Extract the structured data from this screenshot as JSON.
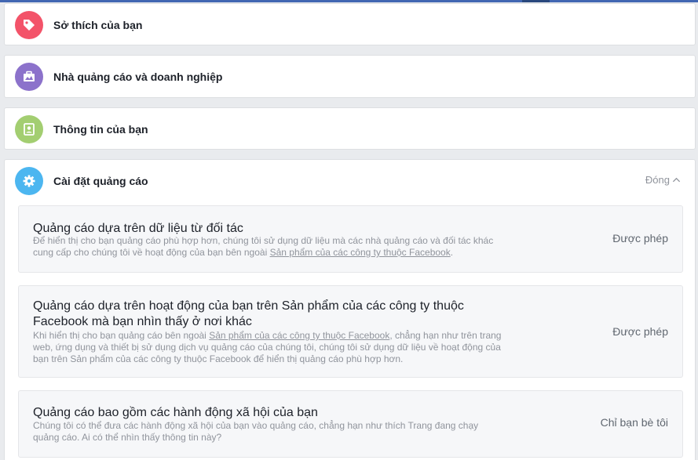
{
  "sections": {
    "interests": {
      "title": "Sở thích của bạn",
      "icon": "tag-icon",
      "color": "#f35369"
    },
    "advertisers": {
      "title": "Nhà quảng cáo và doanh nghiệp",
      "icon": "briefcase-icon",
      "color": "#8c72cb"
    },
    "your_info": {
      "title": "Thông tin của bạn",
      "icon": "id-card-icon",
      "color": "#a3ce71"
    },
    "ad_settings": {
      "title": "Cài đặt quảng cáo",
      "icon": "gear-icon",
      "color": "#4cb6f0",
      "close_label": "Đóng"
    }
  },
  "settings": [
    {
      "title": "Quảng cáo dựa trên dữ liệu từ đối tác",
      "desc_line1": "Để hiển thị cho bạn quảng cáo phù hợp hơn, chúng tôi sử dụng dữ liệu mà các nhà quảng cáo và đối tác khác",
      "desc_line2_pre": "cung cấp cho chúng tôi về hoạt động của bạn bên ngoài ",
      "desc_link": "Sản phẩm của các công ty thuộc Facebook",
      "desc_line2_post": ".",
      "value": "Được phép"
    },
    {
      "title_line1": "Quảng cáo dựa trên hoạt động của bạn trên Sản phẩm của các công ty thuộc",
      "title_line2": "Facebook mà bạn nhìn thấy ở nơi khác",
      "desc_line1_pre": "Khi hiển thị cho bạn quảng cáo bên ngoài ",
      "desc_link": "Sản phẩm của các công ty thuộc Facebook",
      "desc_line1_post": ", chẳng hạn như trên trang",
      "desc_line2": "web, ứng dụng và thiết bị sử dụng dịch vụ quảng cáo của chúng tôi, chúng tôi sử dụng dữ liệu về hoạt động của",
      "desc_line3": "bạn trên Sản phẩm của các công ty thuộc Facebook để hiển thị quảng cáo phù hợp hơn.",
      "value": "Được phép"
    },
    {
      "title": "Quảng cáo bao gồm các hành động xã hội của bạn",
      "desc_line1": "Chúng tôi có thể đưa các hành động xã hội của bạn vào quảng cáo, chẳng hạn như thích Trang đang chạy",
      "desc_line2": "quảng cáo. Ai có thể nhìn thấy thông tin này?",
      "value": "Chỉ bạn bè tôi"
    }
  ]
}
